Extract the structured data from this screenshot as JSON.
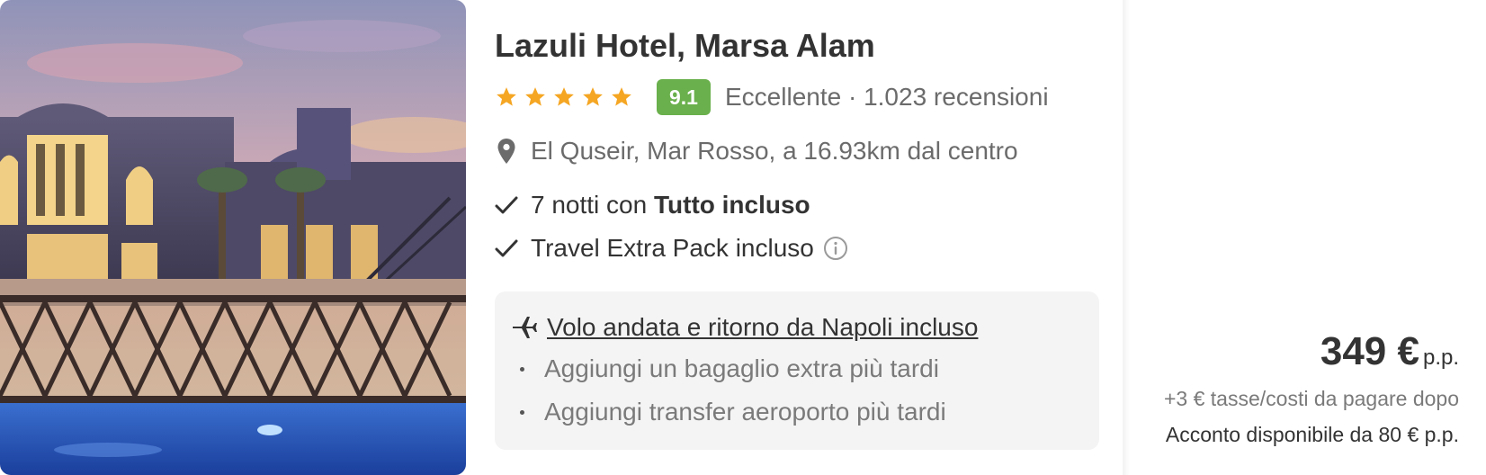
{
  "hotel": {
    "name": "Lazuli Hotel, Marsa Alam",
    "stars": 5,
    "score": "9.1",
    "rating_summary": "Eccellente · 1.023 recensioni",
    "location": "El Quseir, Mar Rosso, a 16.93km dal centro"
  },
  "features": [
    {
      "prefix": "7 notti con ",
      "bold": "Tutto incluso"
    },
    {
      "prefix": "Travel Extra Pack incluso",
      "bold": ""
    }
  ],
  "flight": {
    "title": "Volo andata e ritorno da Napoli incluso",
    "notes": [
      "Aggiungi un bagaglio extra più tardi",
      "Aggiungi transfer aeroporto più tardi"
    ]
  },
  "price": {
    "amount": "349 €",
    "unit": "p.p.",
    "taxes": "+3 € tasse/costi da pagare dopo",
    "deposit": "Acconto disponibile da 80 € p.p."
  },
  "icons": {
    "star": "star-icon",
    "pin": "map-pin-icon",
    "check": "check-icon",
    "info": "info-icon",
    "plane": "plane-icon"
  },
  "colors": {
    "star": "#f5a623",
    "score_bg": "#6ab04c",
    "flight_box_bg": "#f4f4f4",
    "text": "#333333",
    "muted": "#6b6b6b"
  }
}
